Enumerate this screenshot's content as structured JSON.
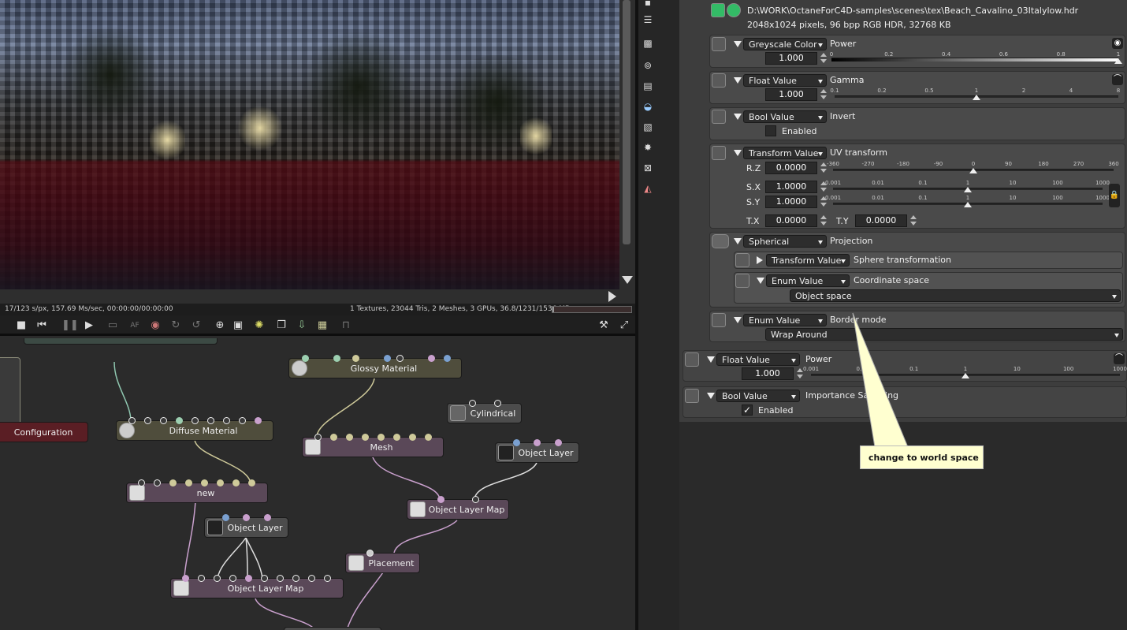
{
  "viewport": {
    "status_left": "17/123 s/px, 157.69 Ms/sec, 00:00:00/00:00:00",
    "status_right": "1 Textures, 23044 Tris, 2 Meshes, 3 GPUs, 36.8/1231/1536 MB",
    "progress": 0.02
  },
  "toolbar": {
    "icons": [
      "stop-icon",
      "rewind-icon",
      "pause-icon",
      "play-icon",
      "screen-icon",
      "af-icon",
      "color-icon",
      "refresh-icon",
      "reset-icon",
      "region-icon",
      "select-icon",
      "focus-icon",
      "copy-icon",
      "export-icon",
      "image-icon",
      "lock-icon",
      "wrench-icon",
      "fullscreen-icon"
    ],
    "af_label": "AF"
  },
  "graph": {
    "nodes": {
      "configuration": "Configuration",
      "diffuse": "Diffuse Material",
      "glossy": "Glossy Material",
      "cylindrical": "Cylindrical",
      "mesh": "Mesh",
      "object_layer_right": "Object Layer",
      "new": "new",
      "object_layer_map_right": "Object Layer Map",
      "object_layer_left": "Object Layer",
      "placement": "Placement",
      "object_layer_map_left": "Object Layer Map"
    }
  },
  "panel": {
    "file_path": "D:\\WORK\\OctaneForC4D-samples\\scenes\\tex\\Beach_Cavalino_03Italylow.hdr",
    "file_info": "2048x1024 pixels, 96 bpp RGB HDR, 32768 KB",
    "power": {
      "type": "Greyscale Color",
      "label": "Power",
      "value": "1.000",
      "ticks": [
        "0",
        "0.2",
        "0.4",
        "0.6",
        "0.8",
        "1"
      ],
      "thumb": 1.0
    },
    "gamma": {
      "type": "Float Value",
      "label": "Gamma",
      "value": "1.000",
      "ticks": [
        "0.1",
        "0.2",
        "0.5",
        "1",
        "2",
        "4",
        "8"
      ],
      "thumb": 1.0
    },
    "invert": {
      "type": "Bool Value",
      "label": "Invert",
      "check_label": "Enabled",
      "checked": false
    },
    "uv": {
      "type": "Transform Value",
      "label": "UV transform",
      "rz_label": "R.Z",
      "rz": "0.0000",
      "rz_ticks": [
        "-360",
        "-270",
        "-180",
        "-90",
        "0",
        "90",
        "180",
        "270",
        "360"
      ],
      "sx_label": "S.X",
      "sx": "1.0000",
      "sy_label": "S.Y",
      "sy": "1.0000",
      "s_ticks": [
        "0.001",
        "0.01",
        "0.1",
        "1",
        "10",
        "100",
        "1000"
      ],
      "tx_label": "T.X",
      "tx": "0.0000",
      "ty_label": "T.Y",
      "ty": "0.0000"
    },
    "projection": {
      "type": "Spherical",
      "label": "Projection",
      "sphere_type": "Transform Value",
      "sphere_label": "Sphere transformation",
      "coord_type": "Enum Value",
      "coord_label": "Coordinate space",
      "coord_value": "Object space"
    },
    "border": {
      "type": "Enum Value",
      "label": "Border mode",
      "value": "Wrap Around"
    },
    "power2": {
      "type": "Float Value",
      "label": "Power",
      "value": "1.000",
      "ticks": [
        "0.001",
        "0.01",
        "0.1",
        "1",
        "10",
        "100",
        "1000"
      ]
    },
    "importance": {
      "type": "Bool Value",
      "label": "Importance Sampling",
      "check_label": "Enabled",
      "checked": true,
      "check_glyph": "✓"
    }
  },
  "callout": {
    "text": "change to world space"
  }
}
